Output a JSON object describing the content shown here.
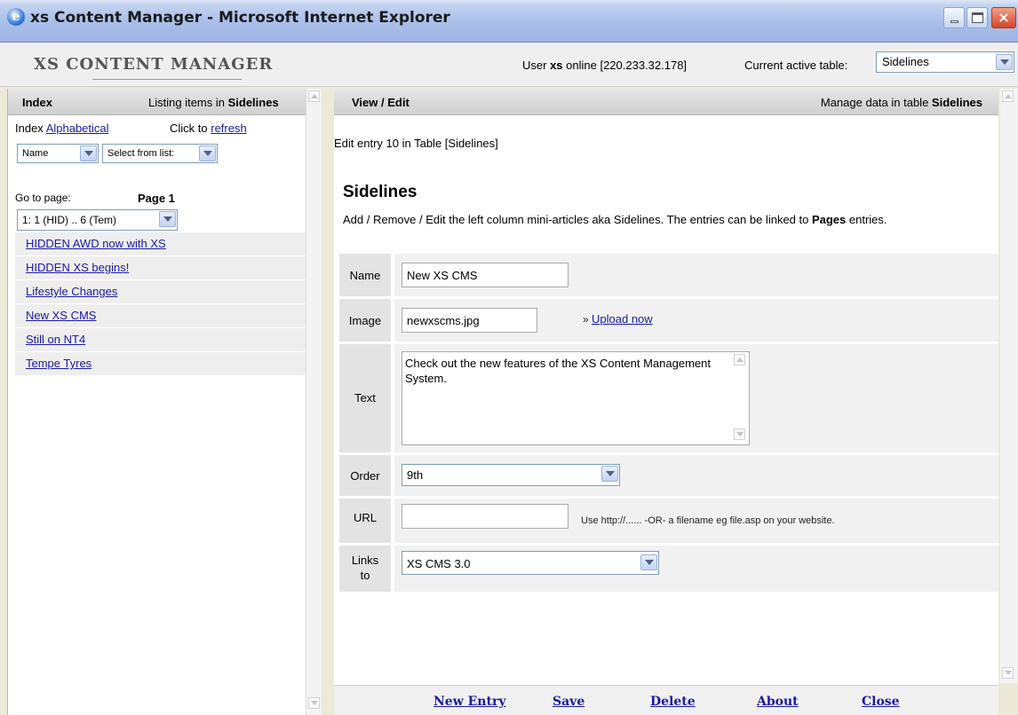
{
  "window": {
    "title": "xs Content Manager - Microsoft Internet Explorer",
    "close_glyph": "×"
  },
  "header": {
    "logo": "XS CONTENT MANAGER",
    "user_prefix": "User ",
    "user_name": "xs",
    "user_suffix": " online [220.233.32.178]",
    "active_table_label": "Current active table:",
    "active_table_value": "Sidelines"
  },
  "left": {
    "title": "Index",
    "listing_prefix": "Listing items in ",
    "listing_table": "Sidelines",
    "index_prefix": "Index ",
    "index_mode": "Alphabetical",
    "refresh_prefix": "Click to ",
    "refresh_link": "refresh",
    "sort_value": "Name",
    "pick_value": "Select from list:",
    "goto_label": "Go to page:",
    "page_label": "Page 1",
    "page_value": "1: 1 (HID) .. 6 (Tem)",
    "entries": [
      "HIDDEN AWD now with XS",
      "HIDDEN XS begins!",
      "Lifestyle Changes",
      "New XS CMS",
      "Still on NT4",
      "Tempe Tyres"
    ]
  },
  "right": {
    "title": "View / Edit",
    "manage_prefix": "Manage data in table ",
    "manage_table": "Sidelines",
    "edit_note": "Edit entry 10 in Table [Sidelines]",
    "section_title": "Sidelines",
    "desc_main": "Add / Remove / Edit the left column mini-articles aka Sidelines. The entries can be linked to ",
    "desc_bold": "Pages",
    "desc_end": " entries."
  },
  "form": {
    "name_label": "Name",
    "name_value": "New XS CMS",
    "image_label": "Image",
    "image_value": "newxscms.jpg",
    "upload_prefix": "» ",
    "upload_link": "Upload now",
    "text_label": "Text",
    "text_value": "Check out the new features of the XS Content Management System.",
    "order_label": "Order",
    "order_value": "9th",
    "url_label": "URL",
    "url_value": "",
    "url_hint": "Use http://...... -OR- a filename eg file.asp on your website.",
    "links_label_1": "Links",
    "links_label_2": "to",
    "links_value": "XS CMS 3.0"
  },
  "footer": {
    "new_entry": "New Entry",
    "save": "Save",
    "delete": "Delete",
    "about": "About",
    "close": "Close"
  }
}
